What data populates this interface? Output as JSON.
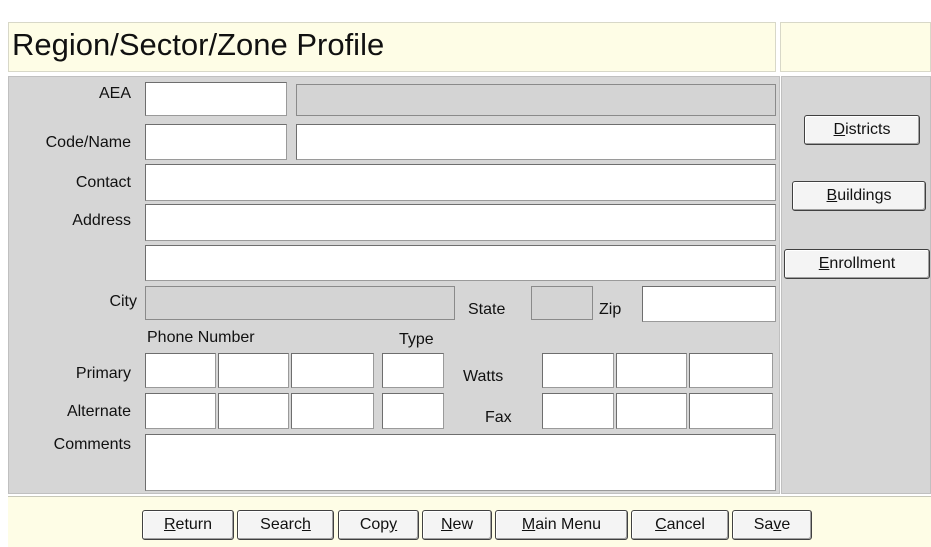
{
  "header": {
    "title": "Region/Sector/Zone Profile"
  },
  "form": {
    "labels": {
      "aea": "AEA",
      "code_name": "Code/Name",
      "contact": "Contact",
      "address": "Address",
      "city": "City",
      "state": "State",
      "zip": "Zip",
      "phone_number": "Phone Number",
      "type": "Type",
      "primary": "Primary",
      "alternate": "Alternate",
      "watts": "Watts",
      "fax": "Fax",
      "comments": "Comments"
    },
    "values": {
      "aea_code": "",
      "aea_name": "",
      "code": "",
      "name": "",
      "contact": "",
      "address1": "",
      "address2": "",
      "city": "",
      "state": "",
      "zip": ""
    }
  },
  "side_buttons": [
    {
      "pre": "",
      "u": "D",
      "post": "istricts"
    },
    {
      "pre": "",
      "u": "B",
      "post": "uildings"
    },
    {
      "pre": "",
      "u": "E",
      "post": "nrollment"
    }
  ],
  "bottom_buttons": [
    {
      "pre": "",
      "u": "R",
      "post": "eturn"
    },
    {
      "pre": "Searc",
      "u": "h",
      "post": ""
    },
    {
      "pre": "Cop",
      "u": "y",
      "post": ""
    },
    {
      "pre": "",
      "u": "N",
      "post": "ew"
    },
    {
      "pre": "",
      "u": "M",
      "post": "ain Menu"
    },
    {
      "pre": "",
      "u": "C",
      "post": "ancel"
    },
    {
      "pre": "Sa",
      "u": "v",
      "post": "e"
    }
  ]
}
